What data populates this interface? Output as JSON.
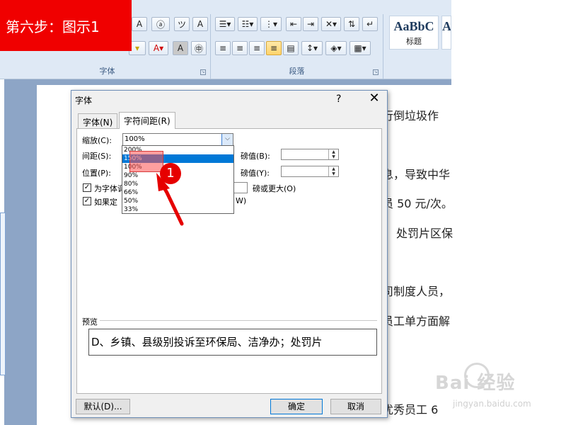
{
  "banner": {
    "text": "第六步：图示1"
  },
  "ribbon": {
    "font_group_label": "字体",
    "paragraph_group_label": "段落",
    "styles": [
      {
        "sample": "AaBbC",
        "name": "标题"
      },
      {
        "sample": "A",
        "name": ""
      }
    ]
  },
  "document": {
    "lines": [
      "行倒垃圾作",
      "息，导致中华",
      "员 50 元/次。",
      "处罚片区保",
      "司制度人员，",
      "员工单方面解",
      "优秀员工 6"
    ]
  },
  "dialog": {
    "title": "字体",
    "help": "?",
    "close": "✕",
    "tabs": [
      {
        "label": "字体(N)"
      },
      {
        "label": "字符间距(R)"
      }
    ],
    "scale_label": "缩放(C):",
    "scale_value": "100%",
    "spacing_label": "间距(S):",
    "position_label": "位置(P):",
    "spacing_by_label": "磅值(B):",
    "position_by_label": "磅值(Y):",
    "kerning_label": "为字体调",
    "kerning_suffix": "磅或更大(O)",
    "snap_label": "如果定",
    "snap_suffix": "W)",
    "scale_options": [
      "200%",
      "150%",
      "100%",
      "90%",
      "80%",
      "66%",
      "50%",
      "33%"
    ],
    "preview_label": "预览",
    "preview_text": "D、乡镇、县级别投诉至环保局、洁净办；处罚片",
    "default_button": "默认(D)...",
    "ok_button": "确定",
    "cancel_button": "取消"
  },
  "annotation": {
    "number": "1"
  },
  "watermark": {
    "text": "Bai 经验",
    "url": "jingyan.baidu.com"
  },
  "colors": {
    "banner": "#f00000",
    "selection": "#0078d7",
    "ribbon": "#dfe9f5"
  }
}
